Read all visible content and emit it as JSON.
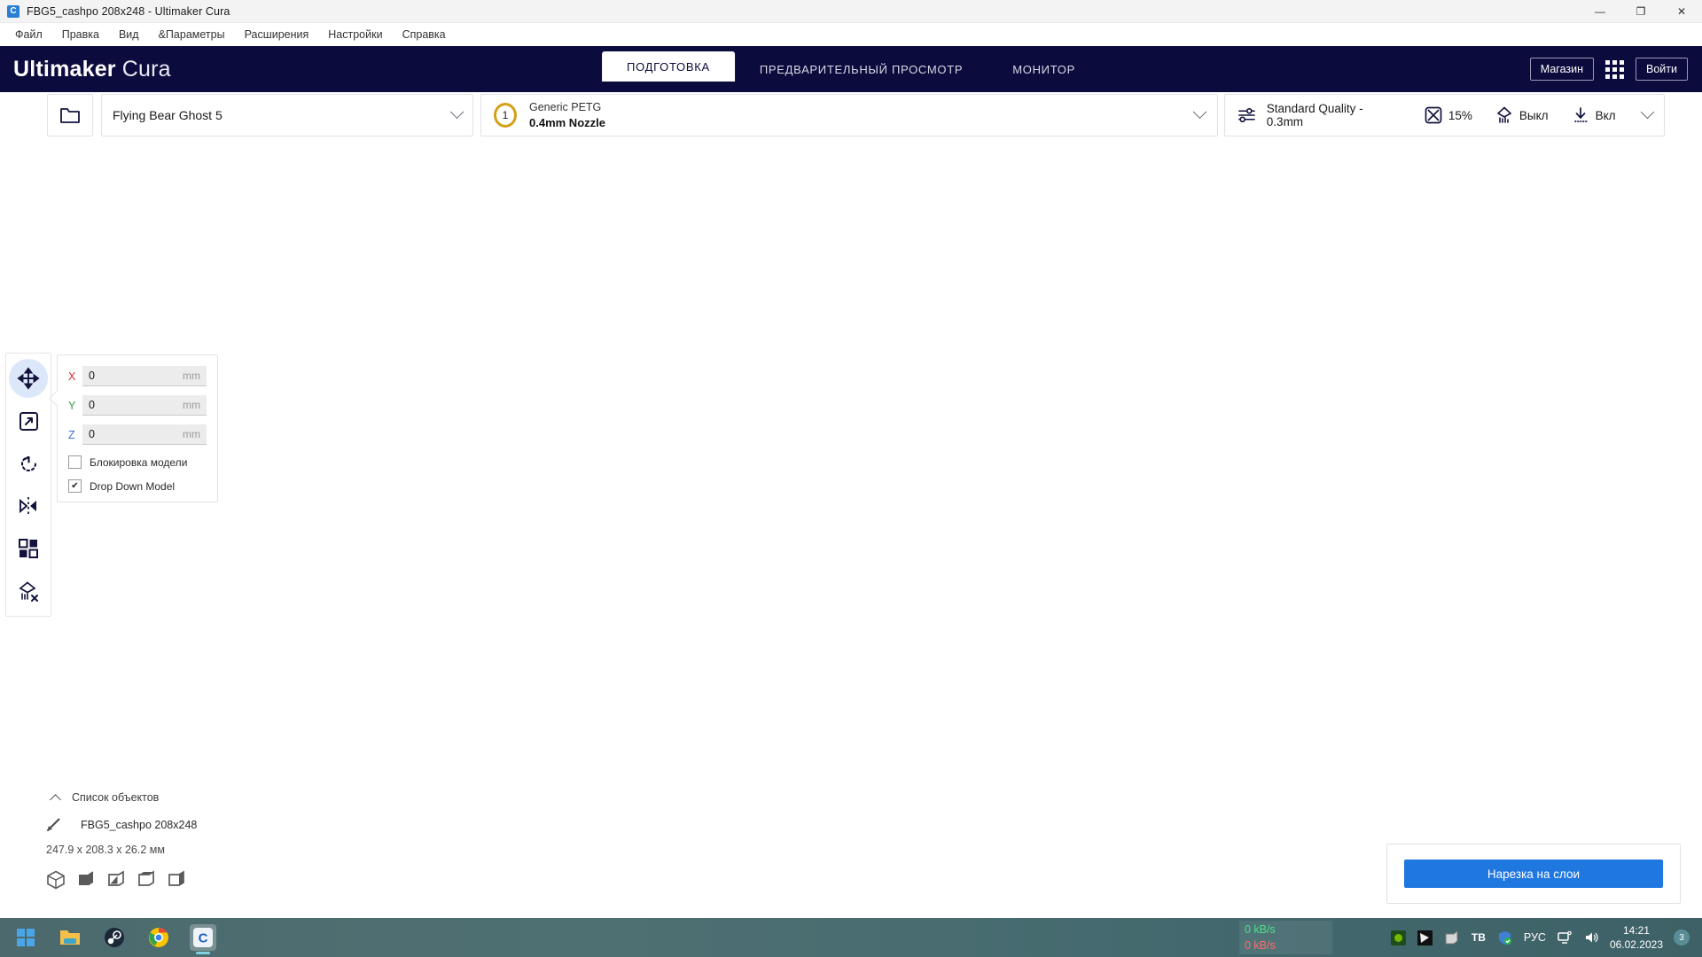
{
  "window": {
    "title": "FBG5_cashpo 208x248 - Ultimaker Cura",
    "app_icon": "cura-icon",
    "minimize": "—",
    "restore": "❐",
    "close": "✕"
  },
  "menubar": {
    "items": [
      {
        "label": "Файл",
        "name": "menu-file"
      },
      {
        "label": "Правка",
        "name": "menu-edit"
      },
      {
        "label": "Вид",
        "name": "menu-view"
      },
      {
        "label": "&Параметры",
        "name": "menu-settings-params"
      },
      {
        "label": "Расширения",
        "name": "menu-extensions"
      },
      {
        "label": "Настройки",
        "name": "menu-preferences"
      },
      {
        "label": "Справка",
        "name": "menu-help"
      }
    ]
  },
  "header": {
    "brand_bold": "Ultimaker",
    "brand_light": "Cura",
    "background": "#0c0b3d",
    "stages": [
      {
        "label": "ПОДГОТОВКА",
        "active": true
      },
      {
        "label": "ПРЕДВАРИТЕЛЬНЫЙ ПРОСМОТР",
        "active": false
      },
      {
        "label": "МОНИТОР",
        "active": false
      }
    ],
    "marketplace_label": "Магазин",
    "signin_label": "Войти",
    "apps_icon": "grid-apps-icon"
  },
  "configbar": {
    "open_file_icon": "folder-open-icon",
    "machine": {
      "name": "Flying Bear Ghost 5",
      "dropdown_icon": "chevron-down-icon"
    },
    "material": {
      "extruder_number": "1",
      "name": "Generic PETG",
      "nozzle": "0.4mm Nozzle",
      "dropdown_icon": "chevron-down-icon"
    },
    "print_settings": {
      "profile_icon": "sliders-icon",
      "profile": "Standard Quality - 0.3mm",
      "infill_icon": "infill-icon",
      "infill_value": "15%",
      "support_icon": "support-icon",
      "support_value": "Выкл",
      "adhesion_icon": "adhesion-icon",
      "adhesion_value": "Вкл",
      "dropdown_icon": "chevron-down-icon"
    }
  },
  "toolbar": {
    "tools": [
      {
        "name": "move-tool",
        "icon": "move-icon",
        "active": true
      },
      {
        "name": "scale-tool",
        "icon": "scale-icon",
        "active": false
      },
      {
        "name": "rotate-tool",
        "icon": "rotate-icon",
        "active": false
      },
      {
        "name": "mirror-tool",
        "icon": "mirror-icon",
        "active": false
      },
      {
        "name": "per-model-settings-tool",
        "icon": "per-model-settings-icon",
        "active": false
      },
      {
        "name": "support-blocker-tool",
        "icon": "support-blocker-icon",
        "active": false
      }
    ]
  },
  "position_panel": {
    "axes": [
      {
        "label": "X",
        "value": "0",
        "unit": "mm"
      },
      {
        "label": "Y",
        "value": "0",
        "unit": "mm"
      },
      {
        "label": "Z",
        "value": "0",
        "unit": "mm"
      }
    ],
    "lock_model": {
      "label": "Блокировка модели",
      "checked": false
    },
    "drop_down_model": {
      "label": "Drop Down Model",
      "checked": true,
      "check_glyph": "✔"
    }
  },
  "object_list": {
    "header": "Список объектов",
    "collapse_icon": "chevron-up-icon",
    "item": {
      "icon": "pencil-icon",
      "name": "FBG5_cashpo 208x248"
    },
    "dimensions": "247.9 x 208.3 x 26.2 мм",
    "view_modes": [
      {
        "name": "view-solid-outline",
        "icon": "cube-outline-icon"
      },
      {
        "name": "view-xray",
        "icon": "cube-filled-icon"
      },
      {
        "name": "view-layers",
        "icon": "cube-half-icon"
      },
      {
        "name": "view-shaded",
        "icon": "cube-top-icon"
      },
      {
        "name": "view-wireframe",
        "icon": "cube-side-icon"
      }
    ]
  },
  "slice_panel": {
    "button_label": "Нарезка на слои",
    "accent_color": "#1f77e0"
  },
  "viewport": {
    "model_name": "FBG5_cashpo 208x248",
    "selection_color": "#1565ff",
    "model_color_light": "#d8d5a8",
    "model_color_dark": "#9a9a96",
    "axis_x_color": "#d62f2f",
    "axis_y_color": "#2ca04a",
    "axis_z_color": "#2d6fd6"
  },
  "taskbar": {
    "apps": [
      {
        "name": "start-button",
        "icon": "windows-logo-icon",
        "active": false
      },
      {
        "name": "file-explorer-button",
        "icon": "folder-icon",
        "active": false
      },
      {
        "name": "steam-button",
        "icon": "steam-icon",
        "active": false
      },
      {
        "name": "chrome-button",
        "icon": "chrome-icon",
        "active": false
      },
      {
        "name": "cura-taskbar-button",
        "icon": "cura-icon",
        "active": true
      }
    ],
    "network": {
      "upload": "0 kB/s",
      "download": "0 kB/s"
    },
    "tray_icons": [
      {
        "name": "nvidia-tray-icon",
        "glyph": "◉"
      },
      {
        "name": "utorrent-tray-icon",
        "glyph": "◢"
      },
      {
        "name": "archive-tray-icon",
        "glyph": "⬛"
      },
      {
        "name": "teamviewer-tray-icon",
        "glyph": "TB"
      },
      {
        "name": "security-tray-icon",
        "glyph": "⛨"
      }
    ],
    "language": "РУС",
    "network_icon": "network-icon",
    "volume_icon": "speaker-icon",
    "time": "14:21",
    "date": "06.02.2023",
    "notification_count": "3"
  }
}
